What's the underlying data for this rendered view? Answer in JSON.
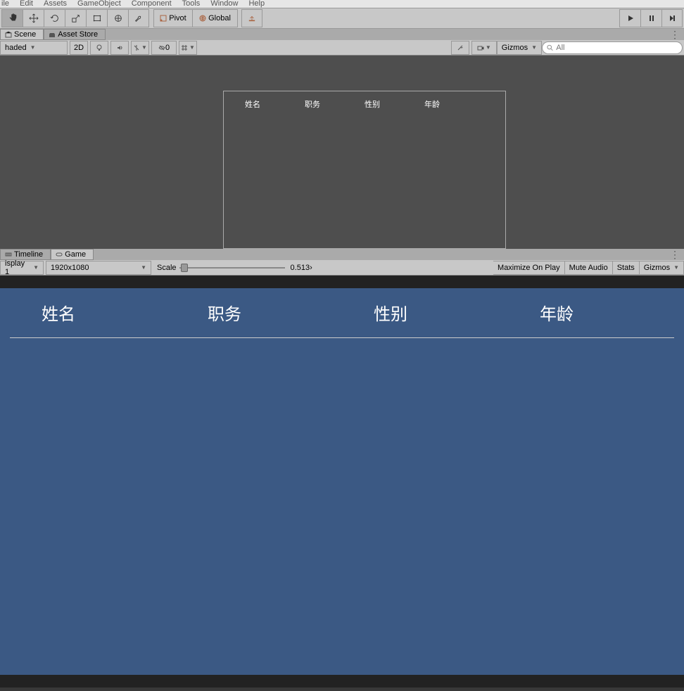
{
  "menu": {
    "items": [
      "ile",
      "Edit",
      "Assets",
      "GameObject",
      "Component",
      "Tools",
      "Window",
      "Help"
    ]
  },
  "toolbar": {
    "pivot": "Pivot",
    "global": "Global"
  },
  "scene_tabs": {
    "scene": "Scene",
    "asset_store": "Asset Store"
  },
  "scene_toolbar": {
    "shading": "haded",
    "button_2d": "2D",
    "hidden_count": "0",
    "gizmos": "Gizmos",
    "search_placeholder": "All"
  },
  "scene_canvas": {
    "headers": [
      "姓名",
      "职务",
      "性别",
      "年龄"
    ]
  },
  "game_tabs": {
    "timeline": "Timeline",
    "game": "Game"
  },
  "game_toolbar": {
    "display": "isplay 1",
    "resolution": "1920x1080",
    "scale_label": "Scale",
    "scale_value": "0.513",
    "maximize": "Maximize On Play",
    "mute": "Mute Audio",
    "stats": "Stats",
    "gizmos": "Gizmos"
  },
  "game_view": {
    "headers": [
      "姓名",
      "职务",
      "性别",
      "年龄"
    ]
  }
}
